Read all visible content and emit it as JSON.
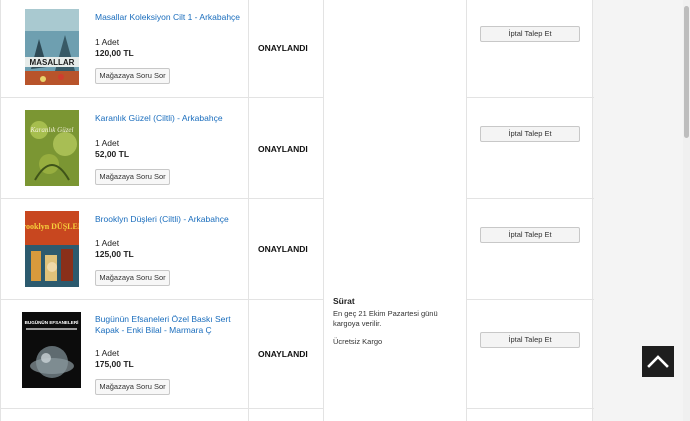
{
  "orders": [
    {
      "title": "Masallar Koleksiyon Cilt 1 - Arkabahçe",
      "quantity": "1 Adet",
      "price": "120,00 TL",
      "ask_label": "Mağazaya Soru Sor",
      "status": "ONAYLANDI",
      "cancel_label": "İptal Talep Et",
      "cover_text": "MASALLAR"
    },
    {
      "title": "Karanlık Güzel (Ciltli) - Arkabahçe",
      "quantity": "1 Adet",
      "price": "52,00 TL",
      "ask_label": "Mağazaya Soru Sor",
      "status": "ONAYLANDI",
      "cancel_label": "İptal Talep Et",
      "cover_text": "Karanlık Güzel"
    },
    {
      "title": "Brooklyn Düşleri (Ciltli) - Arkabahçe",
      "quantity": "1 Adet",
      "price": "125,00 TL",
      "ask_label": "Mağazaya Soru Sor",
      "status": "ONAYLANDI",
      "cancel_label": "İptal Talep Et",
      "cover_text": "Brooklyn DÜŞLERİ"
    },
    {
      "title": "Bugünün Efsaneleri Özel Baskı Sert Kapak - Enki Bilal - Marmara Ç",
      "quantity": "1 Adet",
      "price": "175,00 TL",
      "ask_label": "Mağazaya Soru Sor",
      "status": "ONAYLANDI",
      "cancel_label": "İptal Talep Et",
      "cover_text": "BUGÜNÜN EFSANELERİ"
    }
  ],
  "shipping": {
    "heading": "Sürat",
    "description": "En geç 21 Ekim Pazartesi günü kargoya verilir.",
    "free_label": "Ücretsiz Kargo"
  },
  "icons": {
    "back_to_top": "chevron-up-icon"
  },
  "colors": {
    "link": "#1a6dbd",
    "back_to_top_bg": "#1e1e1e"
  }
}
